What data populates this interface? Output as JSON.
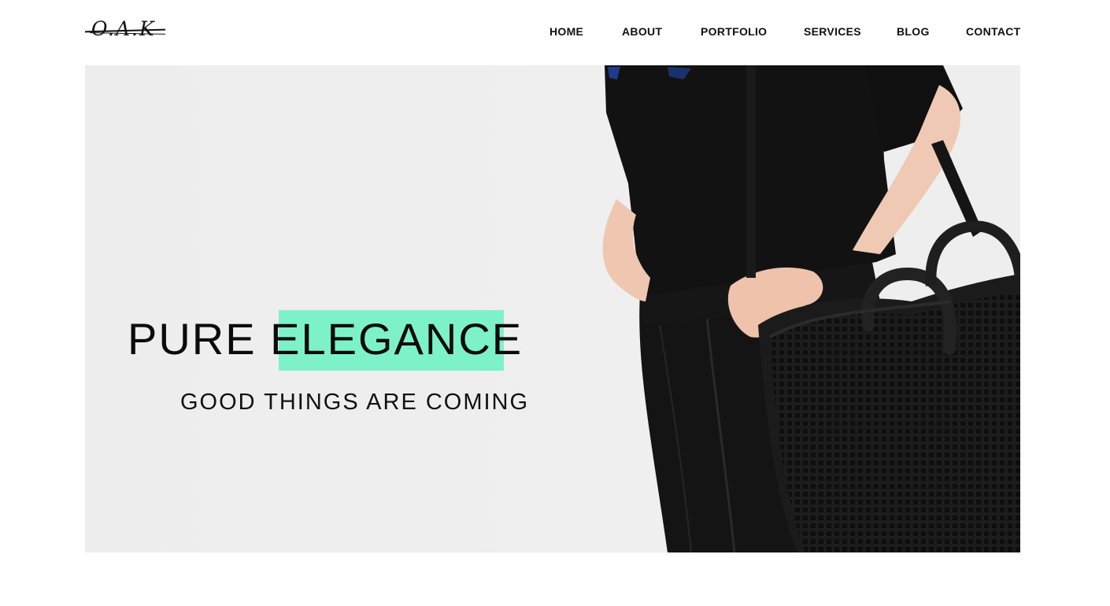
{
  "brand": {
    "logo_text": "O.A.K"
  },
  "nav": {
    "items": [
      {
        "id": "home",
        "label": "HOME"
      },
      {
        "id": "about",
        "label": "ABOUT"
      },
      {
        "id": "portfolio",
        "label": "PORTFOLIO"
      },
      {
        "id": "services",
        "label": "SERVICES"
      },
      {
        "id": "blog",
        "label": "BLOG"
      },
      {
        "id": "contact",
        "label": "CONTACT"
      }
    ]
  },
  "hero": {
    "headline": "PURE ELEGANCE",
    "subline": "GOOD THINGS ARE COMING",
    "highlight_color": "#7df2c9",
    "image_icon": "model-with-handbag-photo"
  }
}
